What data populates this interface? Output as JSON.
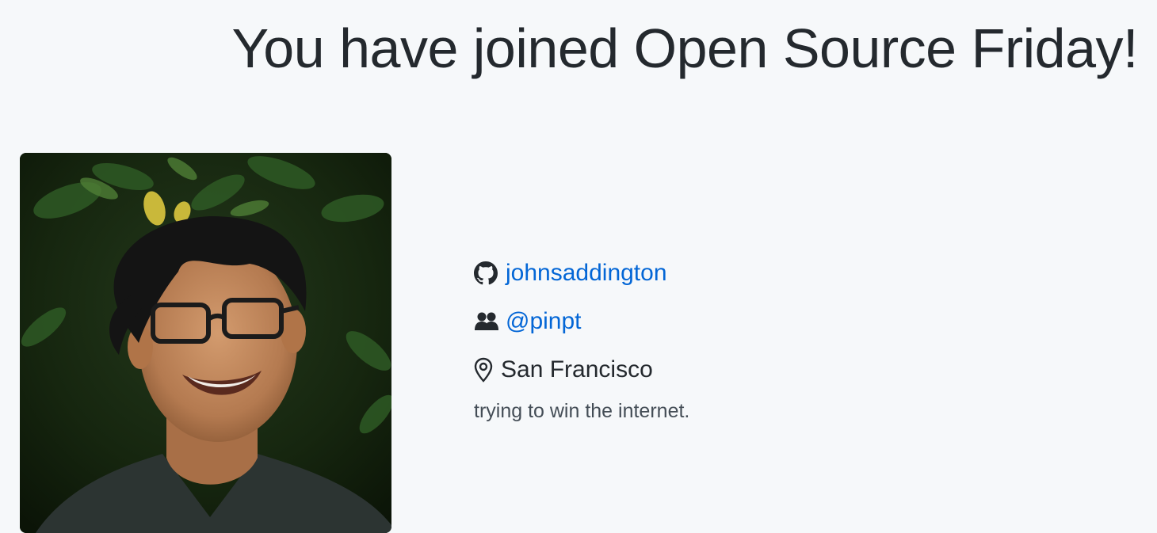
{
  "header": {
    "title": "You have joined Open Source Friday!"
  },
  "profile": {
    "avatar_icon": "avatar-photo",
    "username": "johnsaddington",
    "username_icon": "github-mark-icon",
    "organization": "@pinpt",
    "organization_icon": "people-icon",
    "location": "San Francisco",
    "location_icon": "location-pin-icon",
    "bio": "trying to win the internet."
  },
  "colors": {
    "background": "#f6f8fa",
    "text": "#24292e",
    "link": "#0366d6",
    "muted": "#444d56"
  }
}
